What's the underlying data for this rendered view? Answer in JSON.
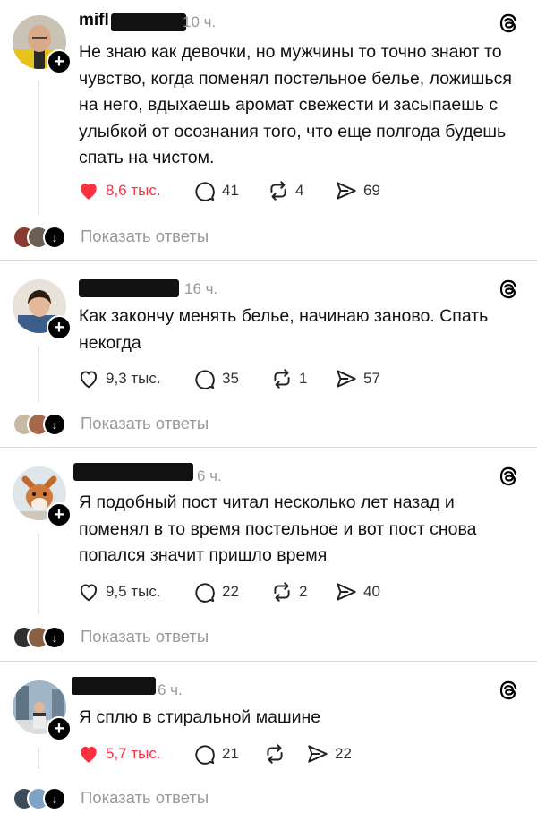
{
  "posts": [
    {
      "username_visible": "mifl",
      "time": "10 ч.",
      "text": "Не знаю как девочки, но мужчины то точно знают то чувство, когда поменял постельное белье, ложишься на него, вдыхаешь аромат свежести и засыпаешь с улыбкой от осознания того, что еще полгода будешь спать на чистом.",
      "likes": "8,6 тыс.",
      "liked": true,
      "comments": "41",
      "reposts": "4",
      "shares": "69",
      "show_replies": "Показать ответы"
    },
    {
      "time": "16 ч.",
      "text": "Как закончу менять белье, начинаю заново. Спать некогда",
      "likes": "9,3 тыс.",
      "liked": false,
      "comments": "35",
      "reposts": "1",
      "shares": "57",
      "show_replies": "Показать ответы"
    },
    {
      "time": "6 ч.",
      "text": "Я подобный пост читал несколько лет назад и поменял в то время постельное и вот пост снова попался значит пришло время",
      "likes": "9,5 тыс.",
      "liked": false,
      "comments": "22",
      "reposts": "2",
      "shares": "40",
      "show_replies": "Показать ответы"
    },
    {
      "time": "6 ч.",
      "text": "Я сплю в стиральной машине",
      "likes": "5,7 тыс.",
      "liked": true,
      "comments": "21",
      "reposts": "",
      "shares": "22",
      "show_replies": "Показать ответы"
    }
  ],
  "colors": {
    "liked": "#ff3040",
    "muted": "#999999",
    "text": "#111111"
  },
  "icons": [
    "heart-icon",
    "comment-icon",
    "repost-icon",
    "share-icon",
    "threads-logo-icon",
    "plus-icon",
    "arrow-down-icon"
  ]
}
